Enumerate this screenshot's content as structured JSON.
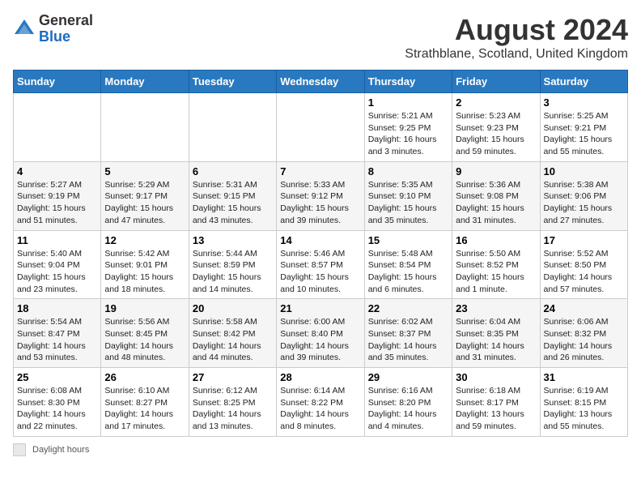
{
  "logo": {
    "general": "General",
    "blue": "Blue"
  },
  "header": {
    "title": "August 2024",
    "subtitle": "Strathblane, Scotland, United Kingdom"
  },
  "weekdays": [
    "Sunday",
    "Monday",
    "Tuesday",
    "Wednesday",
    "Thursday",
    "Friday",
    "Saturday"
  ],
  "footer": {
    "daylight_label": "Daylight hours"
  },
  "weeks": [
    [
      {
        "day": "",
        "info": ""
      },
      {
        "day": "",
        "info": ""
      },
      {
        "day": "",
        "info": ""
      },
      {
        "day": "",
        "info": ""
      },
      {
        "day": "1",
        "info": "Sunrise: 5:21 AM\nSunset: 9:25 PM\nDaylight: 16 hours and 3 minutes."
      },
      {
        "day": "2",
        "info": "Sunrise: 5:23 AM\nSunset: 9:23 PM\nDaylight: 15 hours and 59 minutes."
      },
      {
        "day": "3",
        "info": "Sunrise: 5:25 AM\nSunset: 9:21 PM\nDaylight: 15 hours and 55 minutes."
      }
    ],
    [
      {
        "day": "4",
        "info": "Sunrise: 5:27 AM\nSunset: 9:19 PM\nDaylight: 15 hours and 51 minutes."
      },
      {
        "day": "5",
        "info": "Sunrise: 5:29 AM\nSunset: 9:17 PM\nDaylight: 15 hours and 47 minutes."
      },
      {
        "day": "6",
        "info": "Sunrise: 5:31 AM\nSunset: 9:15 PM\nDaylight: 15 hours and 43 minutes."
      },
      {
        "day": "7",
        "info": "Sunrise: 5:33 AM\nSunset: 9:12 PM\nDaylight: 15 hours and 39 minutes."
      },
      {
        "day": "8",
        "info": "Sunrise: 5:35 AM\nSunset: 9:10 PM\nDaylight: 15 hours and 35 minutes."
      },
      {
        "day": "9",
        "info": "Sunrise: 5:36 AM\nSunset: 9:08 PM\nDaylight: 15 hours and 31 minutes."
      },
      {
        "day": "10",
        "info": "Sunrise: 5:38 AM\nSunset: 9:06 PM\nDaylight: 15 hours and 27 minutes."
      }
    ],
    [
      {
        "day": "11",
        "info": "Sunrise: 5:40 AM\nSunset: 9:04 PM\nDaylight: 15 hours and 23 minutes."
      },
      {
        "day": "12",
        "info": "Sunrise: 5:42 AM\nSunset: 9:01 PM\nDaylight: 15 hours and 18 minutes."
      },
      {
        "day": "13",
        "info": "Sunrise: 5:44 AM\nSunset: 8:59 PM\nDaylight: 15 hours and 14 minutes."
      },
      {
        "day": "14",
        "info": "Sunrise: 5:46 AM\nSunset: 8:57 PM\nDaylight: 15 hours and 10 minutes."
      },
      {
        "day": "15",
        "info": "Sunrise: 5:48 AM\nSunset: 8:54 PM\nDaylight: 15 hours and 6 minutes."
      },
      {
        "day": "16",
        "info": "Sunrise: 5:50 AM\nSunset: 8:52 PM\nDaylight: 15 hours and 1 minute."
      },
      {
        "day": "17",
        "info": "Sunrise: 5:52 AM\nSunset: 8:50 PM\nDaylight: 14 hours and 57 minutes."
      }
    ],
    [
      {
        "day": "18",
        "info": "Sunrise: 5:54 AM\nSunset: 8:47 PM\nDaylight: 14 hours and 53 minutes."
      },
      {
        "day": "19",
        "info": "Sunrise: 5:56 AM\nSunset: 8:45 PM\nDaylight: 14 hours and 48 minutes."
      },
      {
        "day": "20",
        "info": "Sunrise: 5:58 AM\nSunset: 8:42 PM\nDaylight: 14 hours and 44 minutes."
      },
      {
        "day": "21",
        "info": "Sunrise: 6:00 AM\nSunset: 8:40 PM\nDaylight: 14 hours and 39 minutes."
      },
      {
        "day": "22",
        "info": "Sunrise: 6:02 AM\nSunset: 8:37 PM\nDaylight: 14 hours and 35 minutes."
      },
      {
        "day": "23",
        "info": "Sunrise: 6:04 AM\nSunset: 8:35 PM\nDaylight: 14 hours and 31 minutes."
      },
      {
        "day": "24",
        "info": "Sunrise: 6:06 AM\nSunset: 8:32 PM\nDaylight: 14 hours and 26 minutes."
      }
    ],
    [
      {
        "day": "25",
        "info": "Sunrise: 6:08 AM\nSunset: 8:30 PM\nDaylight: 14 hours and 22 minutes."
      },
      {
        "day": "26",
        "info": "Sunrise: 6:10 AM\nSunset: 8:27 PM\nDaylight: 14 hours and 17 minutes."
      },
      {
        "day": "27",
        "info": "Sunrise: 6:12 AM\nSunset: 8:25 PM\nDaylight: 14 hours and 13 minutes."
      },
      {
        "day": "28",
        "info": "Sunrise: 6:14 AM\nSunset: 8:22 PM\nDaylight: 14 hours and 8 minutes."
      },
      {
        "day": "29",
        "info": "Sunrise: 6:16 AM\nSunset: 8:20 PM\nDaylight: 14 hours and 4 minutes."
      },
      {
        "day": "30",
        "info": "Sunrise: 6:18 AM\nSunset: 8:17 PM\nDaylight: 13 hours and 59 minutes."
      },
      {
        "day": "31",
        "info": "Sunrise: 6:19 AM\nSunset: 8:15 PM\nDaylight: 13 hours and 55 minutes."
      }
    ]
  ]
}
